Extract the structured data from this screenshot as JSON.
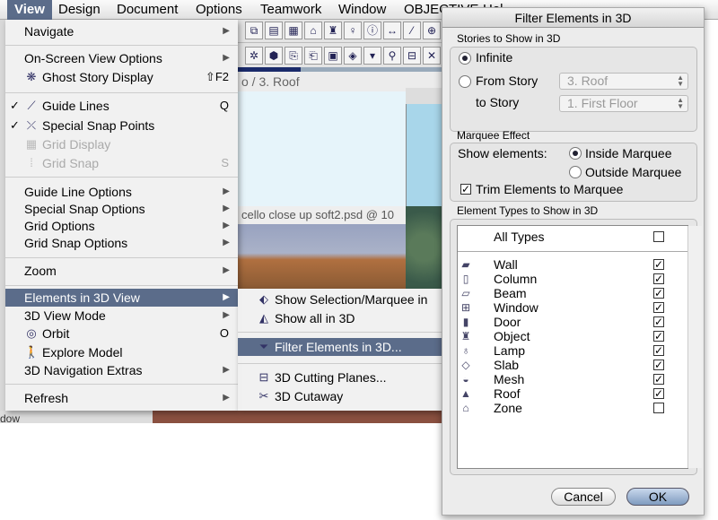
{
  "menubar": {
    "items": [
      "View",
      "Design",
      "Document",
      "Options",
      "Teamwork",
      "Window",
      "OBJECTIVE",
      "Hel"
    ]
  },
  "app": {
    "path": "o / 3. Roof",
    "image_title": "cello close up soft2.psd @ 10",
    "bottom_label": "dow"
  },
  "view_menu": {
    "items": [
      {
        "label": "Navigate",
        "submenu": true
      },
      {
        "label": "On-Screen View Options",
        "submenu": true
      },
      {
        "label": "Ghost Story Display",
        "icon": "ghost-story-icon",
        "shortcut": "⇧F2"
      },
      {
        "label": "Guide Lines",
        "icon": "guide-lines-icon",
        "checked": true,
        "shortcut": "Q"
      },
      {
        "label": "Special Snap Points",
        "icon": "snap-points-icon",
        "checked": true
      },
      {
        "label": "Grid Display",
        "icon": "grid-icon",
        "disabled": true
      },
      {
        "label": "Grid Snap",
        "icon": "grid-snap-icon",
        "disabled": true,
        "shortcut": "S"
      },
      {
        "label": "Guide Line Options",
        "submenu": true
      },
      {
        "label": "Special Snap Options",
        "submenu": true
      },
      {
        "label": "Grid Options",
        "submenu": true
      },
      {
        "label": "Grid Snap Options",
        "submenu": true
      },
      {
        "label": "Zoom",
        "submenu": true
      },
      {
        "label": "Elements in 3D View",
        "submenu": true,
        "highlighted": true
      },
      {
        "label": "3D View Mode",
        "submenu": true
      },
      {
        "label": "Orbit",
        "icon": "orbit-icon",
        "shortcut": "O"
      },
      {
        "label": "Explore Model",
        "icon": "walker-icon"
      },
      {
        "label": "3D Navigation Extras",
        "submenu": true
      },
      {
        "label": "Refresh",
        "submenu": true
      }
    ]
  },
  "elements_submenu": {
    "items": [
      {
        "label": "Show Selection/Marquee in",
        "icon": "show-selection-icon"
      },
      {
        "label": "Show all in 3D",
        "icon": "show-all-icon"
      },
      {
        "label": "Filter Elements in 3D...",
        "icon": "filter-icon",
        "highlighted": true
      },
      {
        "label": "3D Cutting Planes...",
        "icon": "cutting-planes-icon"
      },
      {
        "label": "3D Cutaway",
        "icon": "cutaway-icon"
      }
    ]
  },
  "dialog": {
    "title": "Filter Elements in 3D",
    "stories": {
      "group_label": "Stories to Show in 3D",
      "infinite": "Infinite",
      "from_story": "From Story",
      "to_story": "to Story",
      "selected": "Infinite",
      "from_value": "3. Roof",
      "to_value": "1. First Floor"
    },
    "marquee": {
      "group_label": "Marquee Effect",
      "show_label": "Show elements:",
      "inside": "Inside Marquee",
      "outside": "Outside Marquee",
      "selected": "Inside Marquee",
      "trim": "Trim Elements to Marquee",
      "trim_checked": true
    },
    "types": {
      "group_label": "Element Types to Show in 3D",
      "all_label": "All Types",
      "all_checked": false,
      "items": [
        {
          "name": "Wall",
          "icon": "wall-icon",
          "checked": true
        },
        {
          "name": "Column",
          "icon": "column-icon",
          "checked": true
        },
        {
          "name": "Beam",
          "icon": "beam-icon",
          "checked": true
        },
        {
          "name": "Window",
          "icon": "window-icon",
          "checked": true
        },
        {
          "name": "Door",
          "icon": "door-icon",
          "checked": true
        },
        {
          "name": "Object",
          "icon": "object-icon",
          "checked": true
        },
        {
          "name": "Lamp",
          "icon": "lamp-icon",
          "checked": true
        },
        {
          "name": "Slab",
          "icon": "slab-icon",
          "checked": true
        },
        {
          "name": "Mesh",
          "icon": "mesh-icon",
          "checked": true
        },
        {
          "name": "Roof",
          "icon": "roof-icon",
          "checked": true
        },
        {
          "name": "Zone",
          "icon": "zone-icon",
          "checked": false
        }
      ]
    },
    "cancel": "Cancel",
    "ok": "OK"
  },
  "colors": {
    "highlight": "#5b6c8a"
  }
}
